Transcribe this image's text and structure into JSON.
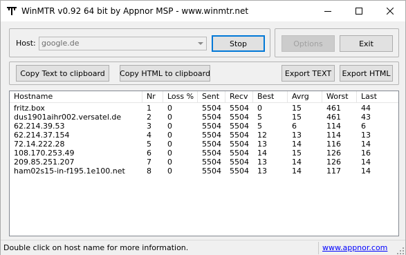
{
  "window": {
    "title": "WinMTR v0.92 64 bit by Appnor MSP - www.winmtr.net"
  },
  "host": {
    "label": "Host:",
    "value": "google.de"
  },
  "buttons": {
    "stop": "Stop",
    "options": "Options",
    "exit": "Exit",
    "copy_text": "Copy Text to clipboard",
    "copy_html": "Copy HTML to clipboard",
    "export_text": "Export TEXT",
    "export_html": "Export HTML"
  },
  "table": {
    "columns": [
      "Hostname",
      "Nr",
      "Loss %",
      "Sent",
      "Recv",
      "Best",
      "Avrg",
      "Worst",
      "Last"
    ],
    "rows": [
      [
        "fritz.box",
        "1",
        "0",
        "5504",
        "5504",
        "0",
        "15",
        "461",
        "44"
      ],
      [
        "dus1901aihr002.versatel.de",
        "2",
        "0",
        "5504",
        "5504",
        "5",
        "15",
        "461",
        "43"
      ],
      [
        "62.214.39.53",
        "3",
        "0",
        "5504",
        "5504",
        "5",
        "6",
        "114",
        "6"
      ],
      [
        "62.214.37.154",
        "4",
        "0",
        "5504",
        "5504",
        "12",
        "13",
        "114",
        "13"
      ],
      [
        "72.14.222.28",
        "5",
        "0",
        "5504",
        "5504",
        "13",
        "14",
        "116",
        "14"
      ],
      [
        "108.170.253.49",
        "6",
        "0",
        "5504",
        "5504",
        "14",
        "15",
        "126",
        "16"
      ],
      [
        "209.85.251.207",
        "7",
        "0",
        "5504",
        "5504",
        "13",
        "14",
        "126",
        "14"
      ],
      [
        "ham02s15-in-f195.1e100.net",
        "8",
        "0",
        "5504",
        "5504",
        "13",
        "14",
        "117",
        "14"
      ]
    ]
  },
  "status": {
    "text": "Double click on host name for more information.",
    "link": "www.appnor.com"
  },
  "icons": {
    "app": "winmtr-app-icon",
    "minimize": "minimize-icon",
    "maximize": "maximize-icon",
    "close": "close-icon",
    "dropdown": "chevron-down-icon",
    "grip": "resize-grip-icon"
  }
}
